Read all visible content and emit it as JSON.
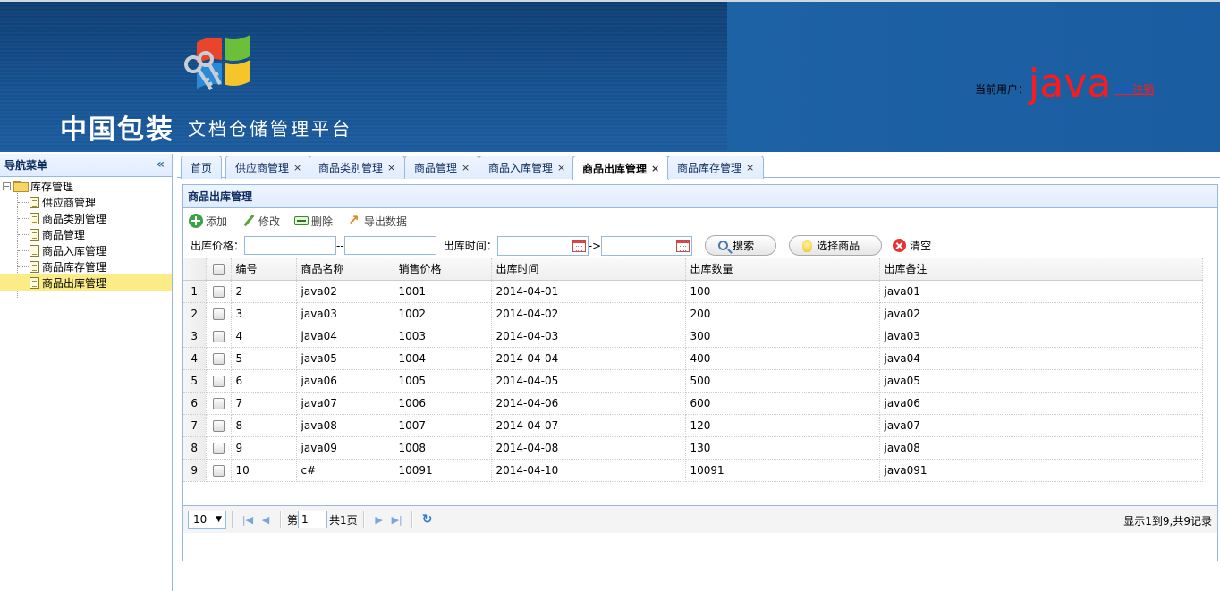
{
  "header": {
    "logo_cn": "中国包装",
    "logo_sub": "文档仓储管理平台",
    "user_label": "当前用户：",
    "user_name": "java",
    "logout_arrow": ">>",
    "logout_label": "注销",
    "accent_color": "#ff1a1a"
  },
  "sidebar": {
    "title": "导航菜单",
    "collapse_icon": "double-chevron-left-icon",
    "root": {
      "label": "库存管理",
      "toggle": "−"
    },
    "items": [
      {
        "label": "供应商管理"
      },
      {
        "label": "商品类别管理"
      },
      {
        "label": "商品管理"
      },
      {
        "label": "商品入库管理"
      },
      {
        "label": "商品库存管理"
      },
      {
        "label": "商品出库管理",
        "selected": true
      }
    ]
  },
  "tabs": [
    {
      "label": "首页",
      "closable": false
    },
    {
      "label": "供应商管理",
      "closable": true
    },
    {
      "label": "商品类别管理",
      "closable": true
    },
    {
      "label": "商品管理",
      "closable": true
    },
    {
      "label": "商品入库管理",
      "closable": true
    },
    {
      "label": "商品出库管理",
      "closable": true,
      "active": true
    },
    {
      "label": "商品库存管理",
      "closable": true
    }
  ],
  "tab_close": "×",
  "panel": {
    "title": "商品出库管理",
    "toolbar": {
      "add": "添加",
      "edit": "修改",
      "delete": "删除",
      "export": "导出数据"
    },
    "search": {
      "price_label": "出库价格：",
      "price_sep": "--",
      "time_label": "出库时间：",
      "time_sep": "->",
      "search_btn": "搜索",
      "select_btn": "选择商品",
      "clear_btn": "清空"
    }
  },
  "grid": {
    "columns": [
      "编号",
      "商品名称",
      "销售价格",
      "出库时间",
      "出库数量",
      "出库备注"
    ],
    "rows": [
      [
        "2",
        "java02",
        "1001",
        "2014-04-01",
        "100",
        "java01"
      ],
      [
        "3",
        "java03",
        "1002",
        "2014-04-02",
        "200",
        "java02"
      ],
      [
        "4",
        "java04",
        "1003",
        "2014-04-03",
        "300",
        "java03"
      ],
      [
        "5",
        "java05",
        "1004",
        "2014-04-04",
        "400",
        "java04"
      ],
      [
        "6",
        "java06",
        "1005",
        "2014-04-05",
        "500",
        "java05"
      ],
      [
        "7",
        "java07",
        "1006",
        "2014-04-06",
        "600",
        "java06"
      ],
      [
        "8",
        "java08",
        "1007",
        "2014-04-07",
        "120",
        "java07"
      ],
      [
        "9",
        "java09",
        "1008",
        "2014-04-08",
        "130",
        "java08"
      ],
      [
        "10",
        "c#",
        "10091",
        "2014-04-10",
        "10091",
        "java091"
      ]
    ]
  },
  "pager": {
    "page_size": "10",
    "page_prefix": "第",
    "page_value": "1",
    "page_total": "共1页",
    "info": "显示1到9,共9记录"
  }
}
